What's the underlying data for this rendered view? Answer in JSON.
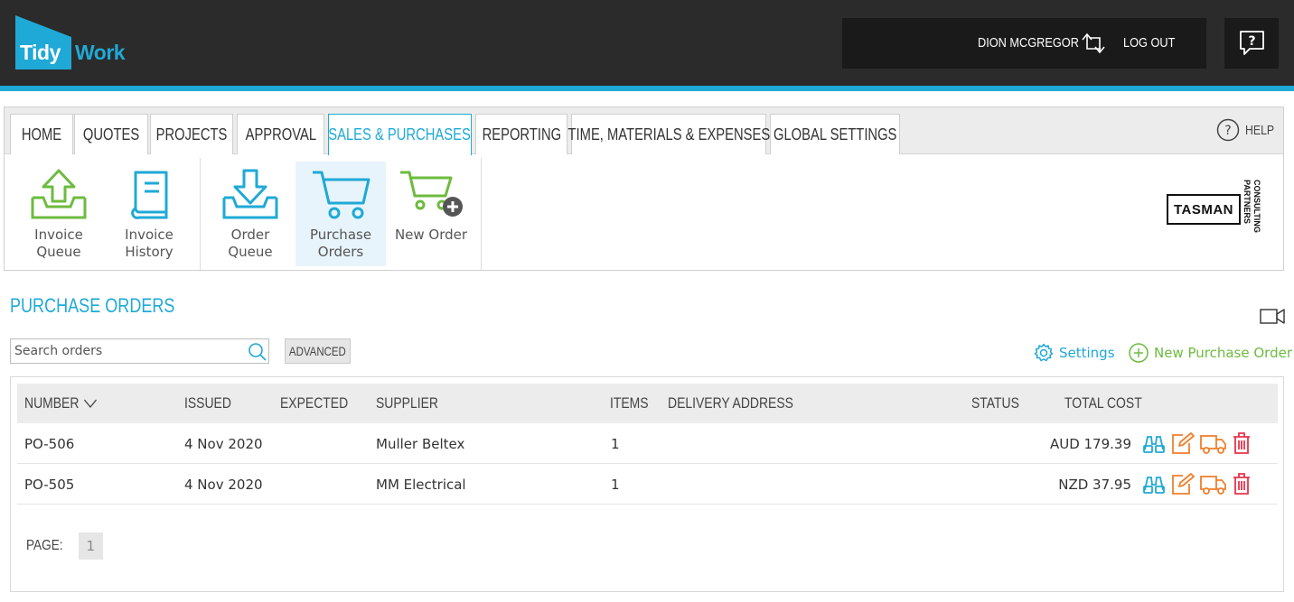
{
  "app": {
    "logo_tidy": "Tidy",
    "logo_work": "Work",
    "user_name": "DION MCGREGOR",
    "logout_label": "LOG OUT"
  },
  "nav": {
    "tabs": [
      {
        "label": "HOME"
      },
      {
        "label": "QUOTES"
      },
      {
        "label": "PROJECTS"
      },
      {
        "label": "APPROVAL"
      },
      {
        "label": "SALES & PURCHASES",
        "active": true
      },
      {
        "label": "REPORTING"
      },
      {
        "label": "TIME, MATERIALS & EXPENSES"
      },
      {
        "label": "GLOBAL SETTINGS"
      }
    ],
    "help_label": "HELP",
    "tools": [
      {
        "line1": "Invoice",
        "line2": "Queue",
        "icon": "upload-tray-icon"
      },
      {
        "line1": "Invoice",
        "line2": "History",
        "icon": "book-icon"
      },
      {
        "line1": "Order",
        "line2": "Queue",
        "icon": "download-tray-icon"
      },
      {
        "line1": "Purchase",
        "line2": "Orders",
        "icon": "cart-icon",
        "active": true
      },
      {
        "line1": "New Order",
        "line2": "",
        "icon": "cart-add-icon"
      }
    ],
    "brand_name": "TASMAN",
    "brand_sub1": "CONSULTING",
    "brand_sub2": "PARTNERS"
  },
  "page": {
    "title": "PURCHASE ORDERS",
    "search_placeholder": "Search orders",
    "advanced_label": "ADVANCED",
    "settings_label": "Settings",
    "new_po_label": "New Purchase Order"
  },
  "table": {
    "columns": {
      "number": "NUMBER",
      "issued": "ISSUED",
      "expected": "EXPECTED",
      "supplier": "SUPPLIER",
      "items": "ITEMS",
      "delivery": "DELIVERY ADDRESS",
      "status": "STATUS",
      "total": "TOTAL COST"
    },
    "rows": [
      {
        "number": "PO-506",
        "issued": "4 Nov 2020",
        "expected": "",
        "supplier": "Muller Beltex",
        "items": "1",
        "delivery": "",
        "status": "",
        "total": "AUD 179.39"
      },
      {
        "number": "PO-505",
        "issued": "4 Nov 2020",
        "expected": "",
        "supplier": "MM Electrical",
        "items": "1",
        "delivery": "",
        "status": "",
        "total": "NZD 37.95"
      }
    ],
    "page_label": "PAGE:",
    "page_number": "1"
  },
  "colors": {
    "accent": "#1fa9d6",
    "green": "#6dbb3f",
    "orange": "#f07f2c",
    "red": "#e8334a",
    "header_bg": "#2b2b2b"
  }
}
